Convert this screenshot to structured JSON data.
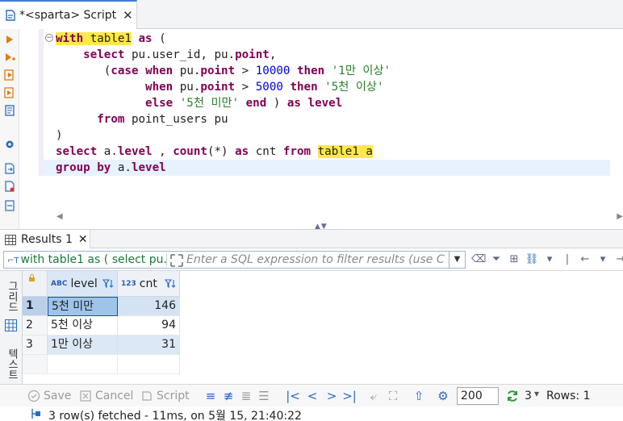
{
  "editor_tab": {
    "title": "*<sparta> Script"
  },
  "editor": {
    "lines": [
      [
        [
          "kw hl",
          "with"
        ],
        [
          "hl",
          " table1"
        ],
        [
          "",
          ""
        ],
        [
          "kw",
          " as"
        ],
        [
          "",
          " ("
        ]
      ],
      [
        [
          "",
          "    "
        ],
        [
          "kw",
          "select"
        ],
        [
          "",
          " pu.user_id, pu."
        ],
        [
          "kw",
          "point"
        ],
        [
          "",
          ","
        ]
      ],
      [
        [
          "",
          "       ("
        ],
        [
          "kw",
          "case"
        ],
        [
          "",
          " "
        ],
        [
          "kw",
          "when"
        ],
        [
          "",
          " pu."
        ],
        [
          "kw",
          "point"
        ],
        [
          "",
          " > "
        ],
        [
          "num",
          "10000"
        ],
        [
          "",
          " "
        ],
        [
          "kw",
          "then"
        ],
        [
          "",
          " "
        ],
        [
          "str",
          "'1만 이상'"
        ]
      ],
      [
        [
          "",
          "             "
        ],
        [
          "kw",
          "when"
        ],
        [
          "",
          " pu."
        ],
        [
          "kw",
          "point"
        ],
        [
          "",
          " > "
        ],
        [
          "num",
          "5000"
        ],
        [
          "",
          " "
        ],
        [
          "kw",
          "then"
        ],
        [
          "",
          " "
        ],
        [
          "str",
          "'5천 이상'"
        ]
      ],
      [
        [
          "",
          "             "
        ],
        [
          "kw",
          "else"
        ],
        [
          "",
          " "
        ],
        [
          "str",
          "'5천 미만'"
        ],
        [
          "",
          " "
        ],
        [
          "kw",
          "end"
        ],
        [
          "",
          " ) "
        ],
        [
          "kw",
          "as"
        ],
        [
          "",
          " "
        ],
        [
          "kw",
          "level"
        ]
      ],
      [
        [
          "",
          "      "
        ],
        [
          "kw",
          "from"
        ],
        [
          "",
          " point_users pu"
        ]
      ],
      [
        [
          "",
          ")"
        ]
      ],
      [
        [
          "kw",
          "select"
        ],
        [
          "",
          " a."
        ],
        [
          "kw",
          "level"
        ],
        [
          "",
          " , "
        ],
        [
          "kw",
          "count"
        ],
        [
          "",
          "(*) "
        ],
        [
          "kw",
          "as"
        ],
        [
          "",
          " cnt "
        ],
        [
          "kw",
          "from"
        ],
        [
          "",
          " "
        ],
        [
          "hl",
          "table1 a"
        ]
      ],
      [
        [
          "kw",
          "group by"
        ],
        [
          "",
          " a."
        ],
        [
          "kw",
          "level"
        ]
      ]
    ]
  },
  "results_tab": {
    "title": "Results 1"
  },
  "filter": {
    "query": "with table1 as ( select pu.",
    "placeholder": "Enter a SQL expression to filter results (use C"
  },
  "side_tabs": {
    "grid": "그리드",
    "text": "텍스트"
  },
  "grid": {
    "columns": [
      {
        "type": "ABC",
        "name": "level"
      },
      {
        "type": "123",
        "name": "cnt"
      }
    ],
    "rows": [
      {
        "num": "1",
        "level": "5천 미만",
        "cnt": "146"
      },
      {
        "num": "2",
        "level": "5천 이상",
        "cnt": "94"
      },
      {
        "num": "3",
        "level": "1만 이상",
        "cnt": "31"
      }
    ]
  },
  "toolbar": {
    "save": "Save",
    "cancel": "Cancel",
    "script": "Script",
    "fetch_size": "200",
    "row_count": "3",
    "rows_label": "Rows: 1"
  },
  "status": {
    "text": "3 row(s) fetched - 11ms, on 5월 15, 21:40:22"
  },
  "colors": {
    "keyword": "#7f0055",
    "number": "#0000dd",
    "string": "#2a7d2a",
    "highlight": "#ffe84a",
    "accent": "#2a6bbf"
  }
}
